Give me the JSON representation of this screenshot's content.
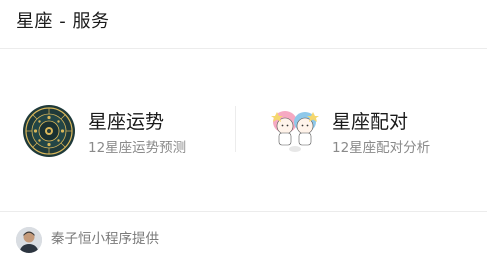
{
  "header": {
    "title": "星座 - 服务"
  },
  "services": [
    {
      "title": "星座运势",
      "description": "12星座运势预测",
      "icon": "zodiac-wheel-icon"
    },
    {
      "title": "星座配对",
      "description": "12星座配对分析",
      "icon": "twin-stars-couple-icon"
    }
  ],
  "footer": {
    "provider_text": "秦子恒小程序提供",
    "avatar": "provider-avatar"
  },
  "colors": {
    "title_text": "#1a1a1a",
    "secondary_text": "#8a8a8a",
    "divider": "#ececec",
    "zodiac_dark": "#1f3a3a",
    "zodiac_gold": "#d9b75a"
  }
}
